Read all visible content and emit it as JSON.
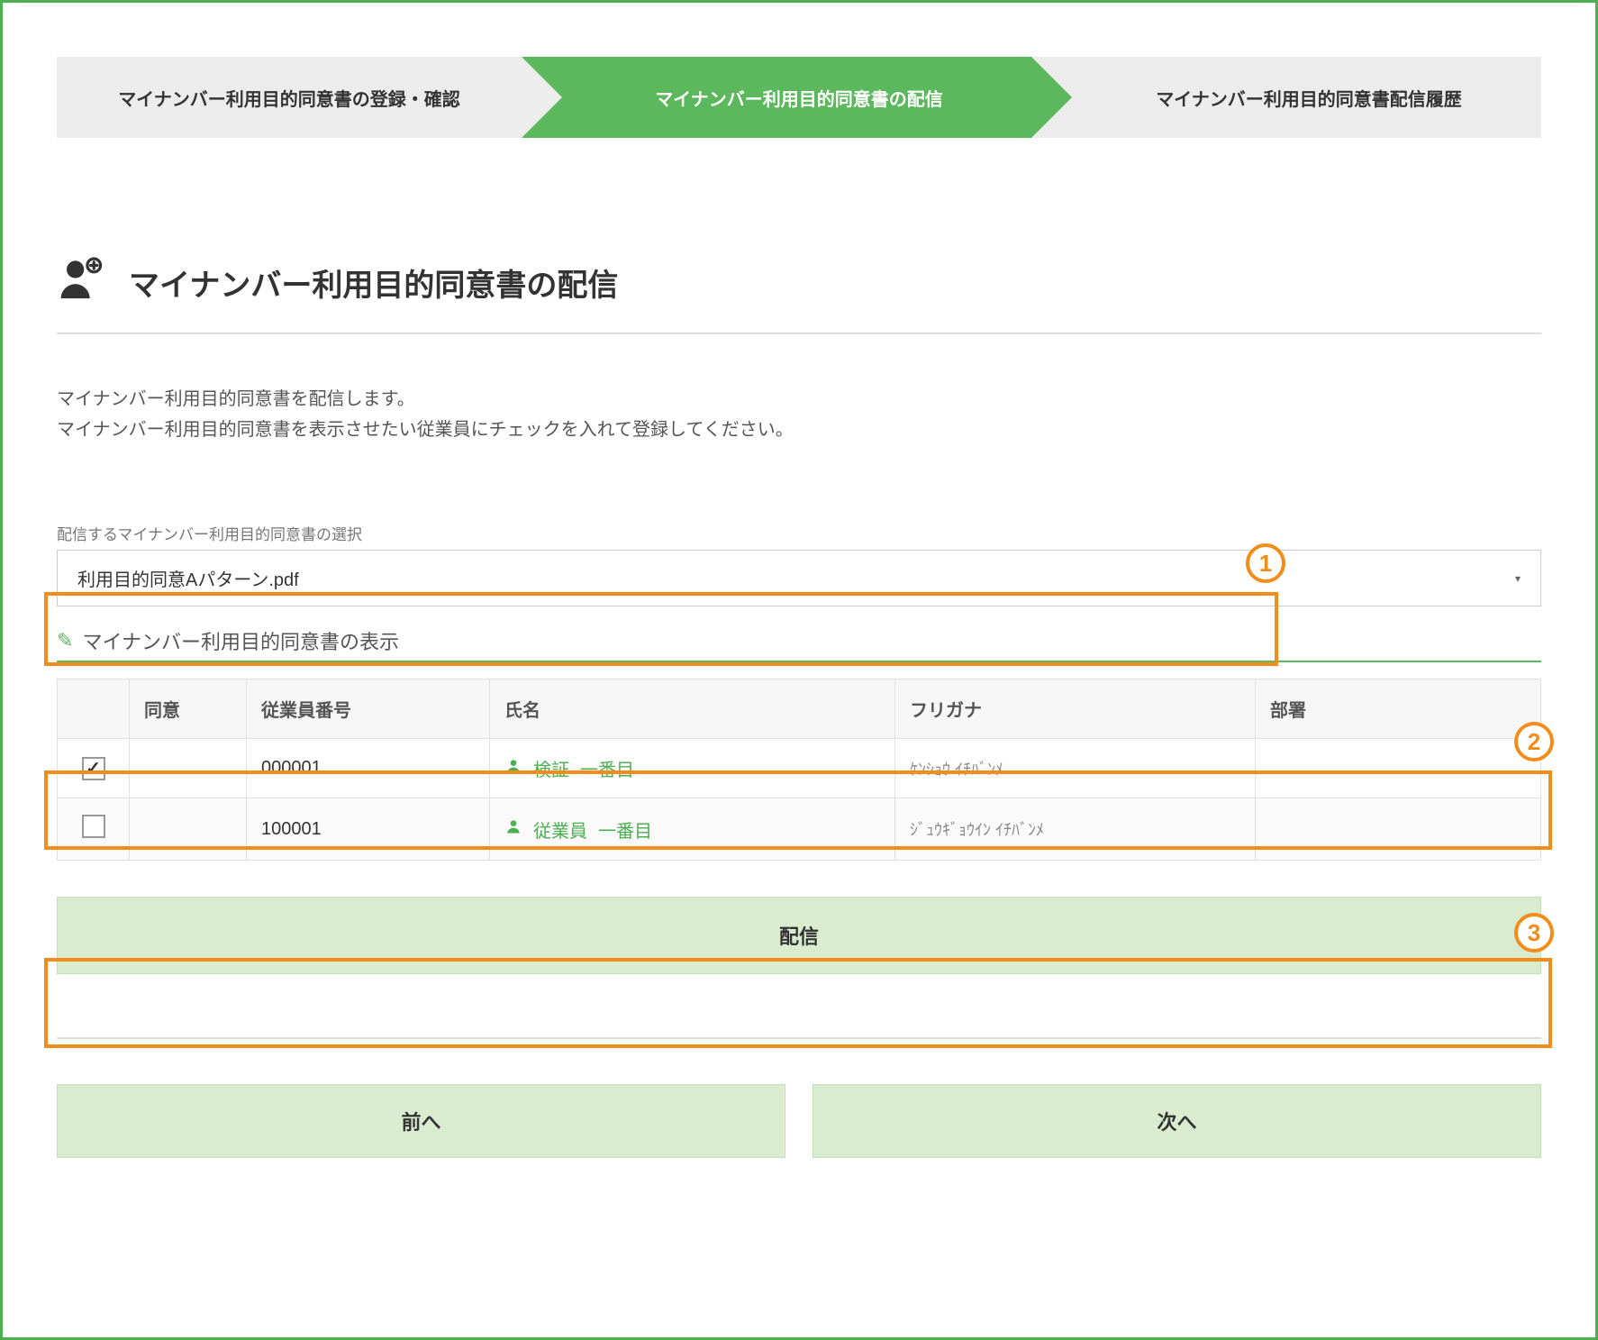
{
  "stepper": {
    "step1": "マイナンバー利用目的同意書の登録・確認",
    "step2": "マイナンバー利用目的同意書の配信",
    "step3": "マイナンバー利用目的同意書配信履歴"
  },
  "page_title": "マイナンバー利用目的同意書の配信",
  "description_line1": "マイナンバー利用目的同意書を配信します。",
  "description_line2": "マイナンバー利用目的同意書を表示させたい従業員にチェックを入れて登録してください。",
  "select_label": "配信するマイナンバー利用目的同意書の選択",
  "select_value": "利用目的同意Aパターン.pdf",
  "section_header": "マイナンバー利用目的同意書の表示",
  "table": {
    "headers": {
      "consent": "同意",
      "emp_no": "従業員番号",
      "name": "氏名",
      "furigana": "フリガナ",
      "dept": "部署"
    },
    "rows": [
      {
        "checked": true,
        "consent": "",
        "emp_no": "000001",
        "name_a": "検証",
        "name_b": "一番目",
        "furigana": "ｹﾝｼｮｳ ｲﾁﾊﾞﾝﾒ",
        "dept": ""
      },
      {
        "checked": false,
        "consent": "",
        "emp_no": "100001",
        "name_a": "従業員",
        "name_b": "一番目",
        "furigana": "ｼﾞｭｳｷﾞｮｳｲﾝ ｲﾁﾊﾞﾝﾒ",
        "dept": ""
      }
    ]
  },
  "distribute_label": "配信",
  "prev_label": "前へ",
  "next_label": "次へ",
  "callouts": {
    "c1": "1",
    "c2": "2",
    "c3": "3"
  }
}
